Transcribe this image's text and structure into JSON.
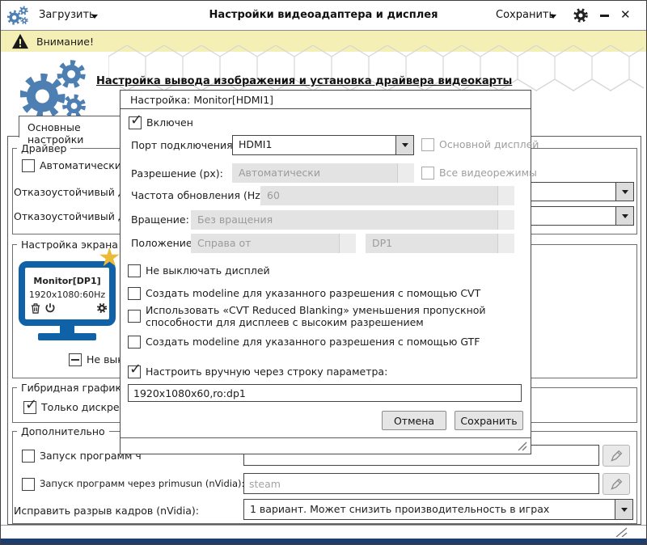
{
  "window": {
    "load_label": "Загрузить",
    "title": "Настройки видеоадаптера и дисплея",
    "save_label": "Сохранить",
    "close_glyph": "✕"
  },
  "warning": {
    "text": "Внимание!"
  },
  "header": {
    "title": "Настройка вывода изображения и установка драйвера видеокарты"
  },
  "main": {
    "tab_label": "Основные настройки",
    "driver": {
      "legend": "Драйвер",
      "auto_label": "Автоматический вы",
      "failsafe1_label": "Отказоустойчивый дра",
      "failsafe2_label": "Отказоустойчивый дра"
    },
    "screen": {
      "legend": "Настройка экрана",
      "monitor_title": "Monitor[DP1]",
      "monitor_mode": "1920x1080:60Hz",
      "keep_on_label": "Не выключать дисп"
    },
    "hybrid": {
      "legend": "Гибридная графика",
      "discrete_label": "Только дискретная"
    },
    "extra": {
      "legend": "Дополнительно",
      "run_opts_label": "Запуск программ ч",
      "primus_label": "Запуск программ через primusun (nVidia):",
      "primus_placeholder": "steam",
      "tear_label": "Исправить разрыв кадров (nVidia):",
      "tear_value": "1 вариант. Может снизить производительность в играх"
    }
  },
  "dialog": {
    "title": "Настройка: Monitor[HDMI1]",
    "enabled_label": "Включен",
    "port_label": "Порт подключения:",
    "port_value": "HDMI1",
    "primary_label": "Основной дисплей",
    "resolution_label": "Разрешение (px):",
    "resolution_value": "Автоматически",
    "allmodes_label": "Все видеорежимы",
    "hz_label": "Частота обновления (Hz):",
    "hz_value": "60",
    "rotation_label": "Вращение:",
    "rotation_value": "Без вращения",
    "position_label": "Положение:",
    "position_value": "Справа от",
    "position_ref": "DP1",
    "checks": [
      {
        "label": "Не выключать дисплей"
      },
      {
        "label": "Создать modeline для указанного разрешения с помощью CVT"
      },
      {
        "label": "Использовать «CVT Reduced Blanking» уменьшения пропускной способности для дисплеев с высоким разрешением"
      },
      {
        "label": "Создать modeline для указанного разрешения с помощью GTF"
      }
    ],
    "manual_label": "Настроить вручную через строку параметра:",
    "manual_value": "1920x1080x60,ro:dp1",
    "cancel_label": "Отмена",
    "save_label": "Сохранить"
  },
  "colors": {
    "accent_blue": "#4d7fb2",
    "monitor_blue": "#0f61a8",
    "star_gold": "#ecba37",
    "warning_bg": "#f3efb5",
    "bottom_bar": "#1d3d6d"
  }
}
